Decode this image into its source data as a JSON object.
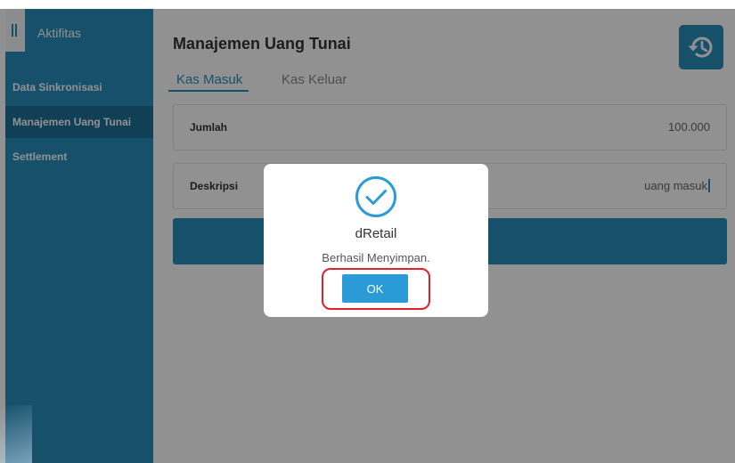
{
  "sidebar": {
    "title": "Aktifitas",
    "items": [
      {
        "label": "Data Sinkronisasi"
      },
      {
        "label": "Manajemen Uang Tunai",
        "active": true
      },
      {
        "label": "Settlement"
      }
    ]
  },
  "main": {
    "title": "Manajemen Uang Tunai",
    "history_icon": "history-icon",
    "tabs": [
      {
        "label": "Kas Masuk",
        "active": true
      },
      {
        "label": "Kas Keluar",
        "active": false
      }
    ],
    "fields": {
      "jumlah": {
        "label": "Jumlah",
        "value": "100.000"
      },
      "deskripsi": {
        "label": "Deskripsi",
        "value": "uang masuk"
      }
    }
  },
  "dialog": {
    "icon": "check-circle-icon",
    "title": "dRetail",
    "message": "Berhasil Menyimpan.",
    "ok_label": "OK"
  },
  "colors": {
    "primary": "#2a8dbd",
    "sidebar_active": "#1d6f97",
    "ok_button": "#2a9bd6",
    "highlight": "#e0202a"
  }
}
